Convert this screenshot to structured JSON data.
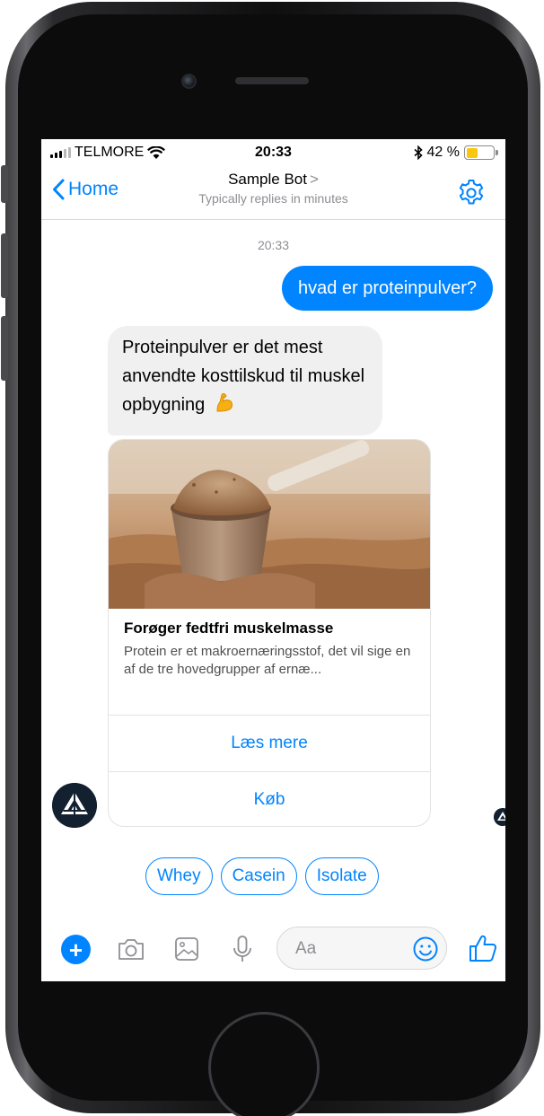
{
  "status_bar": {
    "carrier": "TELMORE",
    "time": "20:33",
    "battery_percent": "42 %",
    "battery_level": 0.42
  },
  "nav": {
    "back_label": "Home",
    "title": "Sample Bot",
    "title_chevron": ">",
    "subtitle": "Typically replies in minutes"
  },
  "conversation": {
    "timestamp": "20:33",
    "outgoing_message": "hvad er proteinpulver?",
    "incoming_message": "Proteinpulver er det mest anvendte kosttilskud til muskel opbygning",
    "incoming_emoji": "flexed-biceps-emoji"
  },
  "card": {
    "image": "protein-powder-scoop-image",
    "title": "Forøger fedtfri muskelmasse",
    "description": "Protein er et makroernæringsstof, det vil sige en af de tre hovedgrupper af ernæ...",
    "buttons": [
      "Læs mere",
      "Køb"
    ]
  },
  "quick_replies": [
    "Whey",
    "Casein",
    "Isolate"
  ],
  "composer": {
    "placeholder": "Aa"
  },
  "colors": {
    "accent": "#0084ff",
    "incoming_bubble": "#f1f0f0",
    "battery": "#f9c80e",
    "avatar": "#13202f"
  }
}
